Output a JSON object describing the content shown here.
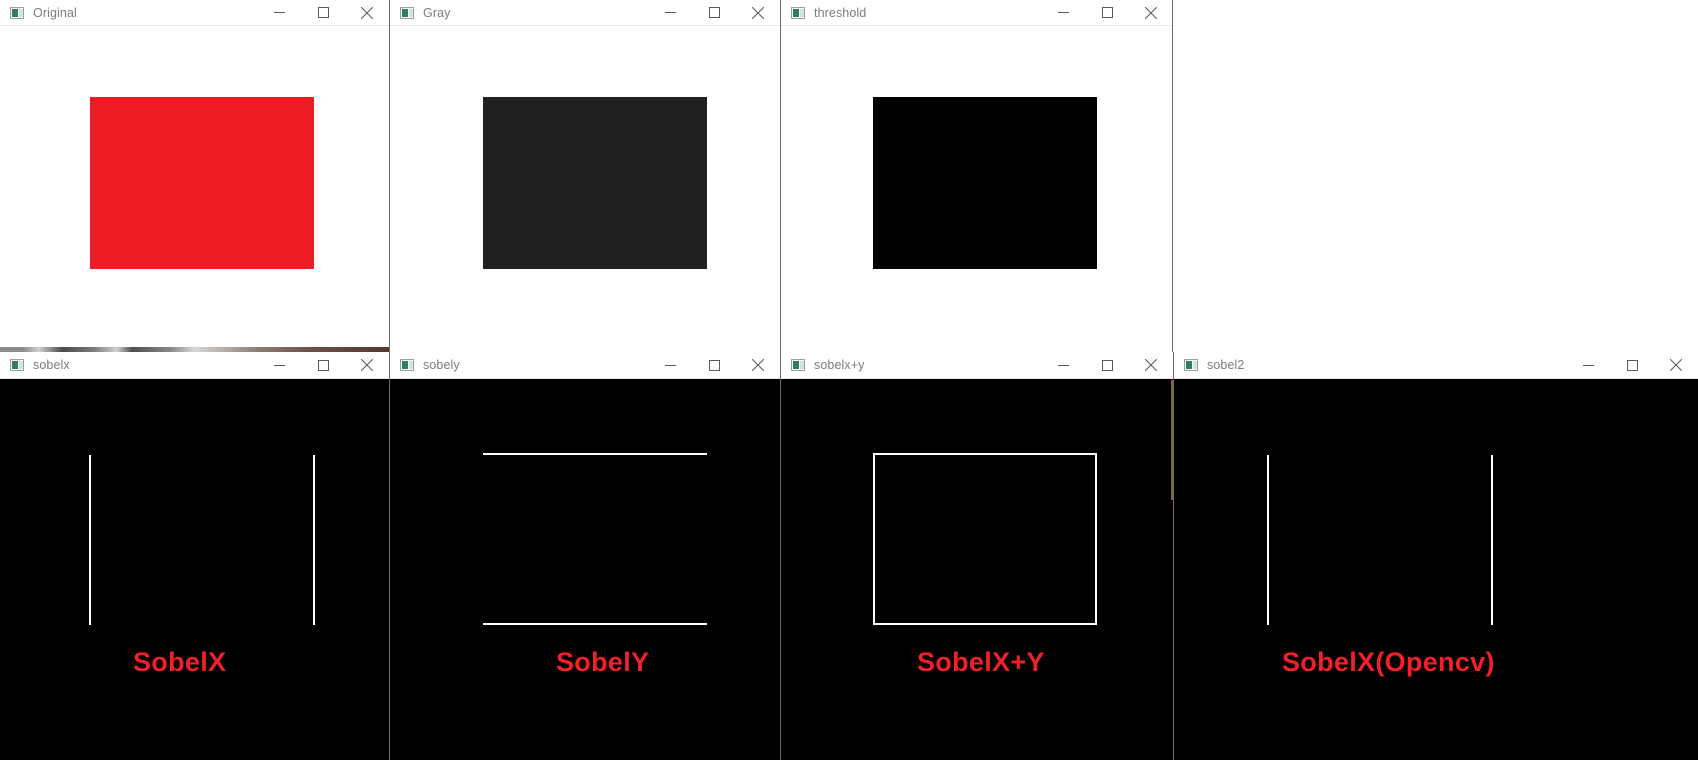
{
  "desktop": {
    "background_color": "#ffffff"
  },
  "icons": {
    "app_icon": "opencv-window-icon",
    "minimize": "minimize-icon",
    "maximize": "maximize-icon",
    "close": "close-icon"
  },
  "window_controls": {
    "minimize_label": "Minimize",
    "maximize_label": "Maximize",
    "close_label": "Close"
  },
  "colors": {
    "red": "#ED1C24",
    "gray_fill": "#212121",
    "black": "#000000",
    "white": "#ffffff",
    "label_red": "#EF2029",
    "titlebar_text": "#7c7c7c"
  },
  "windows": [
    {
      "id": "original",
      "title": "Original",
      "content_type": "solid-rectangle",
      "shape_color": "#ED1C24",
      "label": ""
    },
    {
      "id": "gray",
      "title": "Gray",
      "content_type": "solid-rectangle",
      "shape_color": "#212121",
      "label": ""
    },
    {
      "id": "threshold",
      "title": "threshold",
      "content_type": "solid-rectangle",
      "shape_color": "#000000",
      "label": ""
    },
    {
      "id": "sobelx",
      "title": "sobelx",
      "content_type": "edges-vertical",
      "shape_color": "#ffffff",
      "label": "SobelX"
    },
    {
      "id": "sobely",
      "title": "sobely",
      "content_type": "edges-horizontal",
      "shape_color": "#ffffff",
      "label": "SobelY"
    },
    {
      "id": "sobelxy",
      "title": "sobelx+y",
      "content_type": "edges-rectangle",
      "shape_color": "#ffffff",
      "label": "SobelX+Y"
    },
    {
      "id": "sobel2",
      "title": "sobel2",
      "content_type": "edges-vertical",
      "shape_color": "#ffffff",
      "label": "SobelX(Opencv)"
    }
  ]
}
